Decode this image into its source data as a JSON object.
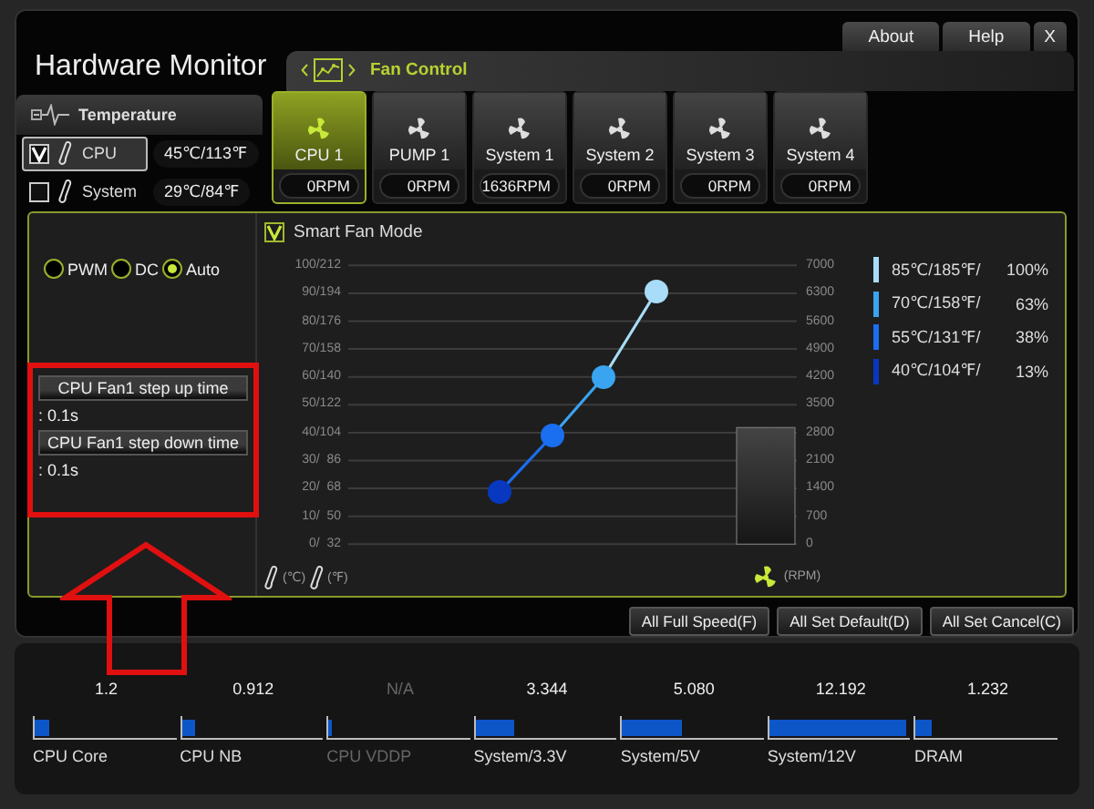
{
  "window": {
    "title": "Hardware Monitor",
    "buttons": [
      "About",
      "Help",
      "X"
    ]
  },
  "temperature": {
    "title": "Temperature",
    "sensors": [
      {
        "name": "CPU",
        "value": "45℃/113℉",
        "checked": true,
        "selected": true
      },
      {
        "name": "System",
        "value": "29℃/84℉",
        "checked": false,
        "selected": false
      }
    ]
  },
  "fan_control": {
    "title": "Fan Control",
    "fans": [
      {
        "name": "CPU 1",
        "rpm": "0RPM",
        "selected": true
      },
      {
        "name": "PUMP 1",
        "rpm": "0RPM",
        "selected": false
      },
      {
        "name": "System 1",
        "rpm": "1636RPM",
        "selected": false
      },
      {
        "name": "System 2",
        "rpm": "0RPM",
        "selected": false
      },
      {
        "name": "System 3",
        "rpm": "0RPM",
        "selected": false
      },
      {
        "name": "System 4",
        "rpm": "0RPM",
        "selected": false
      }
    ],
    "modes": [
      {
        "label": "PWM",
        "selected": false
      },
      {
        "label": "DC",
        "selected": false
      },
      {
        "label": "Auto",
        "selected": true
      }
    ],
    "step_settings": [
      {
        "label": "CPU Fan1 step up time",
        "value": ": 0.1s"
      },
      {
        "label": "CPU Fan1 step down time",
        "value": ": 0.1s"
      }
    ],
    "smart_fan_mode": {
      "label": "Smart Fan Mode",
      "checked": true
    },
    "temp_ticks": [
      "100/212",
      "90/194",
      "80/176",
      "70/158",
      "60/140",
      "50/122",
      "40/104",
      "30/  86",
      "20/  68",
      "10/  50",
      "0/  32"
    ],
    "rpm_ticks": [
      "7000",
      "6300",
      "5600",
      "4900",
      "4200",
      "3500",
      "2800",
      "2100",
      "1400",
      "700",
      "0"
    ],
    "temp_units": [
      "(℃)",
      "(℉)"
    ],
    "rpm_unit": "(RPM)",
    "curve_points": [
      {
        "label": "85℃/185℉/",
        "percent": "100%",
        "color": "#a8dcf8"
      },
      {
        "label": "70℃/158℉/",
        "percent": "63%",
        "color": "#3aa4f0"
      },
      {
        "label": "55℃/131℉/",
        "percent": "38%",
        "color": "#1a6ef0"
      },
      {
        "label": "40℃/104℉/",
        "percent": "13%",
        "color": "#0838c0"
      }
    ]
  },
  "actions": [
    "All Full Speed(F)",
    "All Set Default(D)",
    "All Set Cancel(C)"
  ],
  "voltages": [
    {
      "name": "CPU Core",
      "value": "1.2",
      "level": 0.1,
      "disabled": false
    },
    {
      "name": "CPU NB",
      "value": "0.912",
      "level": 0.09,
      "disabled": false
    },
    {
      "name": "CPU VDDP",
      "value": "N/A",
      "level": 0.02,
      "disabled": true
    },
    {
      "name": "System/3.3V",
      "value": "3.344",
      "level": 0.28,
      "disabled": false
    },
    {
      "name": "System/5V",
      "value": "5.080",
      "level": 0.42,
      "disabled": false
    },
    {
      "name": "System/12V",
      "value": "12.192",
      "level": 0.97,
      "disabled": false
    },
    {
      "name": "DRAM",
      "value": "1.232",
      "level": 0.11,
      "disabled": false
    }
  ]
}
